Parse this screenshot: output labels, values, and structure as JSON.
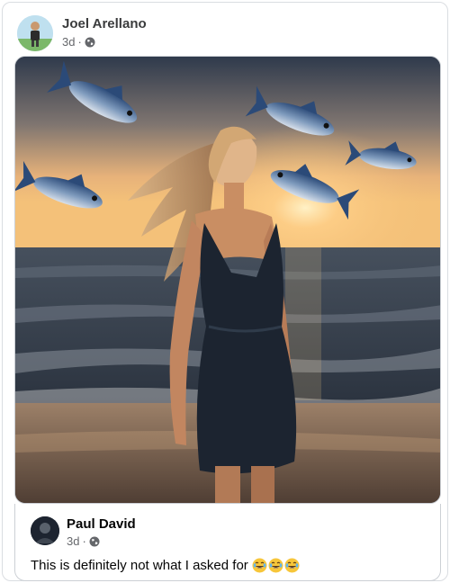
{
  "post": {
    "author": "Joel Arellano",
    "time": "3d",
    "separator": "·",
    "privacy_icon": "globe-icon"
  },
  "image": {
    "subject": "woman-walking-beach-flying-fish",
    "colors": {
      "sky_top": "#2f3a4c",
      "sunset": "#f4c179",
      "sea": "#3b4656",
      "sand": "#8b6d55"
    }
  },
  "comment": {
    "author": "Paul David",
    "time": "3d",
    "separator": "·",
    "privacy_icon": "globe-icon",
    "text": "This is definitely not what I asked for",
    "reactions": [
      "laughing-emoji",
      "laughing-emoji",
      "laughing-emoji"
    ]
  }
}
